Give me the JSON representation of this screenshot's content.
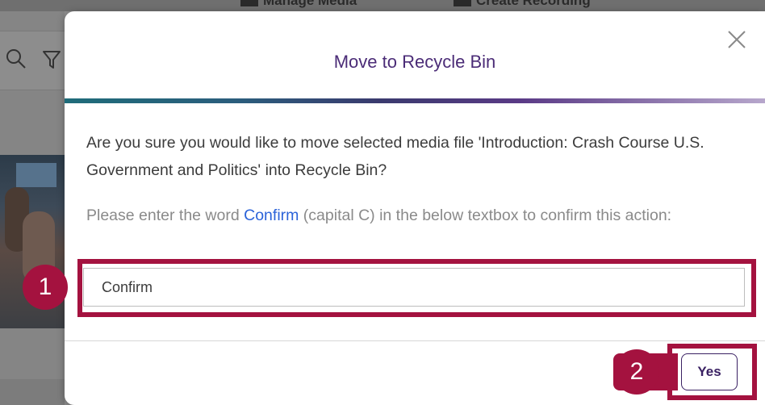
{
  "background": {
    "topbar_left": "Manage Media",
    "topbar_right": "Create Recording",
    "icons": [
      "search-icon",
      "filter-icon"
    ]
  },
  "dialog": {
    "title": "Move to Recycle Bin",
    "message": "Are you sure you would like to move selected media file 'Introduction: Crash Course U.S. Government and Politics' into Recycle Bin?",
    "instruction_before": "Please enter the word ",
    "instruction_word": "Confirm",
    "instruction_after": " (capital C) in the below textbox to confirm this action:",
    "input_value": "Confirm",
    "yes_label": "Yes",
    "close_icon": "close-icon"
  },
  "annotations": {
    "step1": "1",
    "step2": "2",
    "color": "#a4123f"
  },
  "colors": {
    "title": "#4b2c77",
    "link": "#2b63d9",
    "accent": "#a4123f"
  }
}
